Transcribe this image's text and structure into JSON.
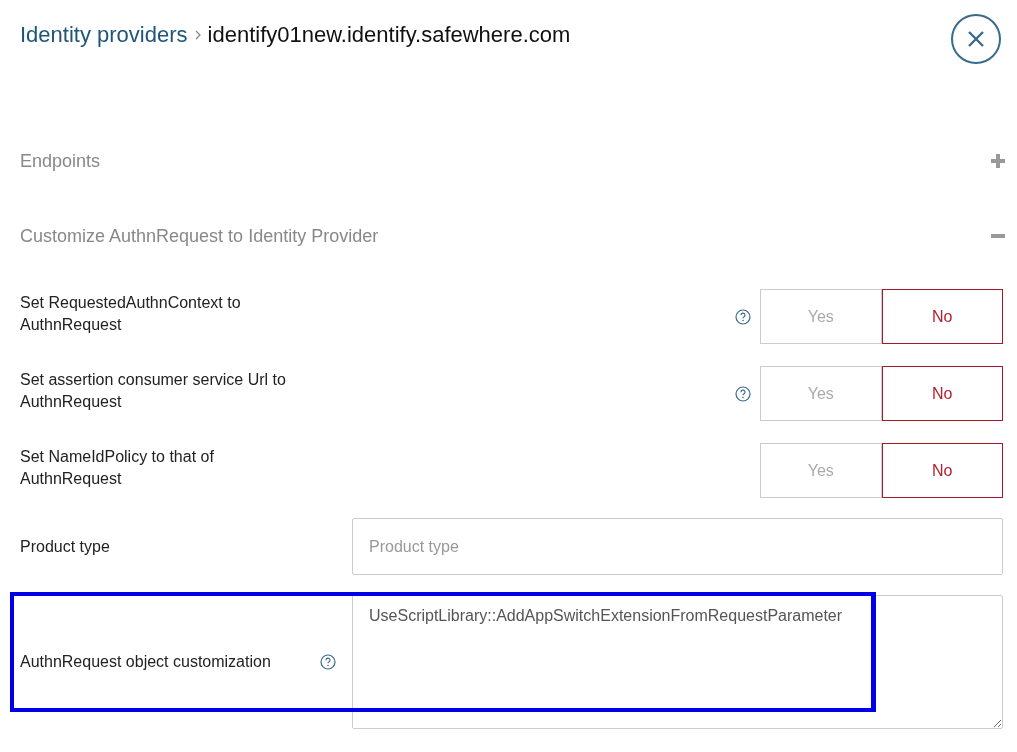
{
  "breadcrumb": {
    "parent": "Identity providers",
    "current": "identify01new.identify.safewhere.com"
  },
  "sections": [
    {
      "title": "Endpoints",
      "expanded": false
    },
    {
      "title": "Customize AuthnRequest to Identity Provider",
      "expanded": true
    }
  ],
  "toggles": [
    {
      "label": "Set RequestedAuthnContext to AuthnRequest",
      "help": true,
      "options": [
        {
          "label": "Yes",
          "selected": false
        },
        {
          "label": "No",
          "selected": true
        }
      ]
    },
    {
      "label": "Set assertion consumer service Url to AuthnRequest",
      "help": true,
      "options": [
        {
          "label": "Yes",
          "selected": false
        },
        {
          "label": "No",
          "selected": true
        }
      ]
    },
    {
      "label": "Set NameIdPolicy to that of AuthnRequest",
      "help": false,
      "options": [
        {
          "label": "Yes",
          "selected": false
        },
        {
          "label": "No",
          "selected": true
        }
      ]
    }
  ],
  "product_type": {
    "label": "Product type",
    "placeholder": "Product type"
  },
  "customization": {
    "label": "AuthnRequest object customization",
    "help": true,
    "value": "UseScriptLibrary::AddAppSwitchExtensionFromRequestParameter",
    "highlighted": true
  }
}
